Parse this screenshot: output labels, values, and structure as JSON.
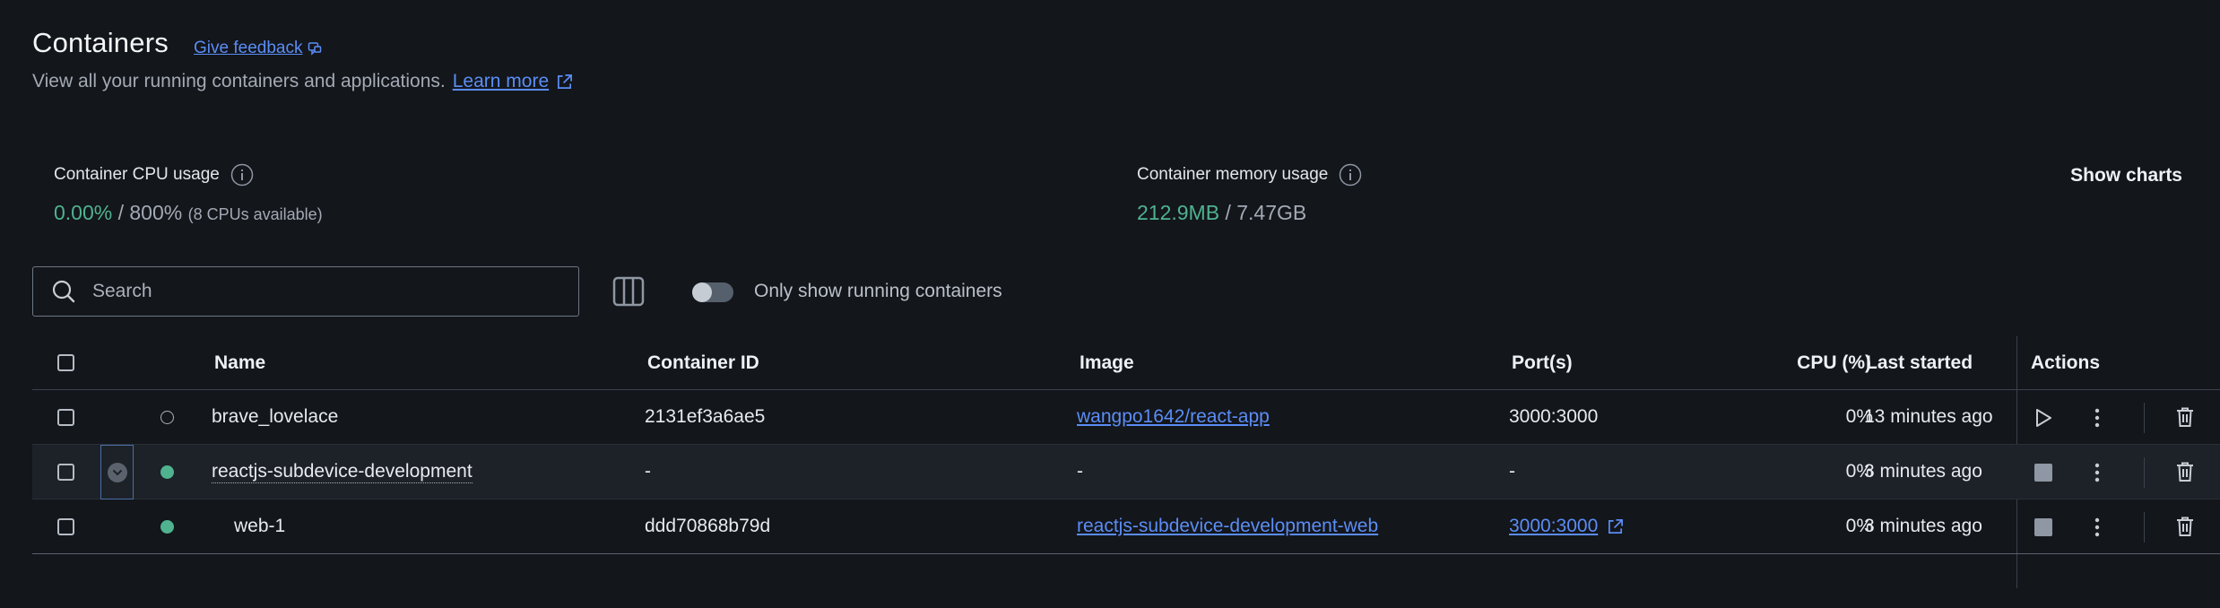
{
  "header": {
    "title": "Containers",
    "feedback": "Give feedback",
    "subtitle": "View all your running containers and applications.",
    "learn_more": "Learn more"
  },
  "stats": {
    "cpu": {
      "label": "Container CPU usage",
      "used": "0.00%",
      "sep_total": " / 800%",
      "extra": "(8 CPUs available)"
    },
    "memory": {
      "label": "Container memory usage",
      "used": "212.9MB",
      "sep_total": " / 7.47GB"
    },
    "show_charts": "Show charts"
  },
  "toolbar": {
    "search_placeholder": "Search",
    "toggle_label": "Only show running containers",
    "toggle_on": false
  },
  "table": {
    "columns": {
      "name": "Name",
      "container_id": "Container ID",
      "image": "Image",
      "ports": "Port(s)",
      "cpu": "CPU (%)",
      "last_started": "Last started",
      "actions": "Actions"
    },
    "rows": [
      {
        "name": "brave_lovelace",
        "container_id": "2131ef3a6ae5",
        "image": "wangpo1642/react-app",
        "ports": "3000:3000",
        "cpu": "0%",
        "last_started": "13 minutes ago",
        "status": "stopped"
      },
      {
        "name": "reactjs-subdevice-development",
        "container_id": "-",
        "image": "-",
        "ports": "-",
        "cpu": "0%",
        "last_started": "3 minutes ago",
        "status": "running"
      },
      {
        "name": "web-1",
        "container_id": "ddd70868b79d",
        "image": "reactjs-subdevice-development-web",
        "ports": "3000:3000",
        "cpu": "0%",
        "last_started": "3 minutes ago",
        "status": "running"
      }
    ]
  },
  "colors": {
    "background": "#13161b",
    "accent_link": "#5b8df5",
    "running_green": "#4fb38f"
  },
  "icons": [
    "external-link-icon",
    "info-icon",
    "search-icon",
    "columns-icon",
    "chevron-down-icon",
    "play-icon",
    "stop-icon",
    "more-vertical-icon",
    "trash-icon"
  ]
}
